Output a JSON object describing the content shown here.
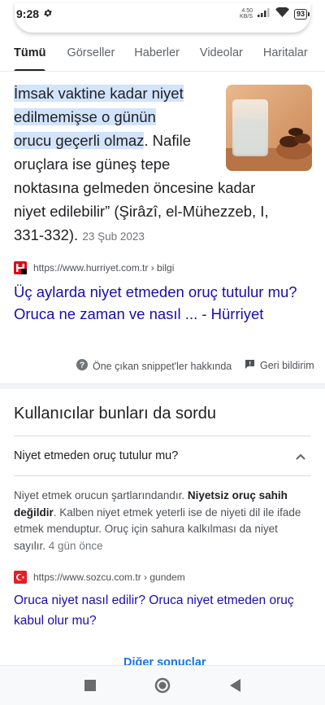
{
  "status_bar": {
    "time": "9:28",
    "net_speed_value": "4.50",
    "net_speed_unit": "KB/S",
    "battery": "93"
  },
  "tabs": [
    {
      "label": "Tümü",
      "active": true
    },
    {
      "label": "Görseller"
    },
    {
      "label": "Haberler"
    },
    {
      "label": "Videolar"
    },
    {
      "label": "Haritalar"
    }
  ],
  "featured_snippet": {
    "highlighted_lines": [
      "İmsak vaktine kadar niyet",
      "edilmemişse o günün",
      "orucu geçerli olmaz"
    ],
    "text_line3_rest": ". Nafile",
    "rest_lines": [
      "oruçlara ise güneş tepe",
      "noktasına gelmeden öncesine kadar",
      "niyet edilebilir” (Şirâzî, el-Mühezzeb, I,"
    ],
    "last_line": "331-332).",
    "date": "23 Şub 2023",
    "source_url": "https://www.hurriyet.com.tr › bilgi",
    "title": "Üç aylarda niyet etmeden oruç tutulur mu? Oruca ne zaman ve nasıl ... - Hürriyet",
    "about_label": "Öne çıkan snippet'ler hakkında",
    "feedback_label": "Geri bildirim"
  },
  "people_also_ask": {
    "heading": "Kullanıcılar bunları da sordu",
    "question": "Niyet etmeden oruç tutulur mu?",
    "answer_part1": "Niyet etmek orucun şartlarındandır. ",
    "answer_bold": "Niyetsiz oruç sahih değildir",
    "answer_part2": ". Kalben niyet etmek yeterli ise de niyeti dil ile ifade etmek menduptur. Oruç için sahura kalkılması da niyet sayılır.",
    "answer_date": "4 gün önce",
    "source_url": "https://www.sozcu.com.tr › gundem",
    "link_title": "Oruca niyet nasıl edilir? Oruca niyet etmeden oruç kabul olur mu?"
  },
  "more_results_label": "Diğer sonuçlar",
  "colors": {
    "link": "#1a0dab",
    "highlight": "#d2e3fc",
    "accent": "#1a73e8",
    "hurriyet_red": "#e30613",
    "sozcu_red": "#e31e24"
  }
}
